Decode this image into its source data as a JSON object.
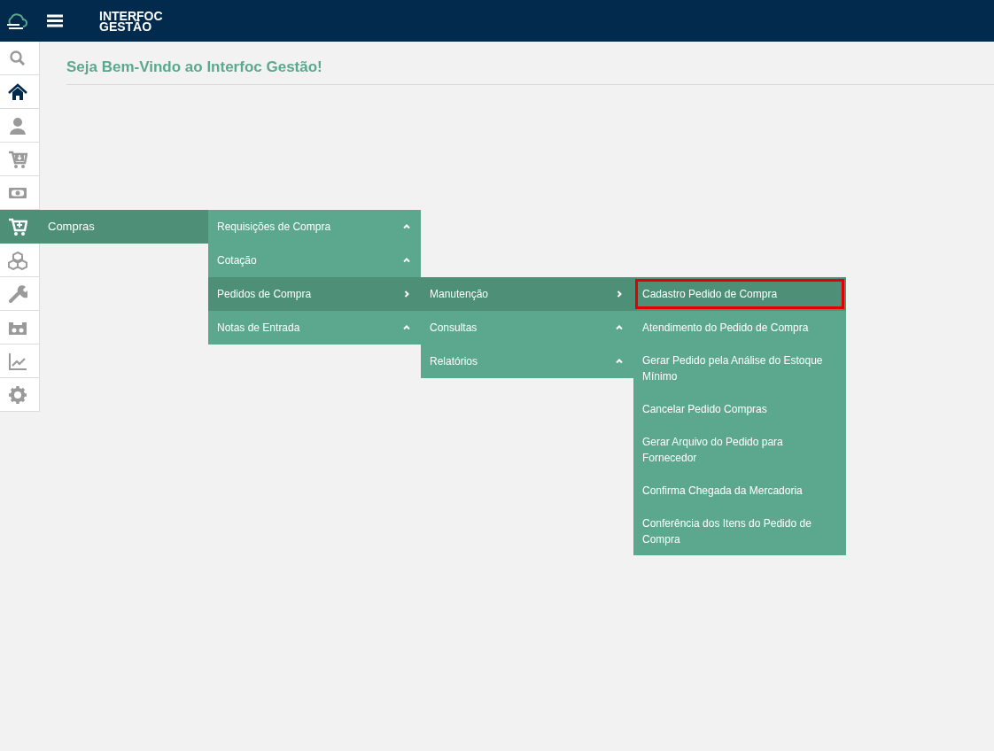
{
  "header": {
    "brand_line1": "INTERFOC",
    "brand_line2": "GESTÃO"
  },
  "sidebar": {
    "items": [
      {
        "kind": "search",
        "current": false,
        "selected": false
      },
      {
        "kind": "home",
        "current": true,
        "selected": false
      },
      {
        "kind": "user",
        "current": false,
        "selected": false
      },
      {
        "kind": "cart-down",
        "current": false,
        "selected": false
      },
      {
        "kind": "money",
        "current": false,
        "selected": false
      },
      {
        "kind": "cart-plus",
        "current": false,
        "selected": true,
        "label": "Compras",
        "children": [
          {
            "label": "Requisições de Compra",
            "kind": "submenu",
            "selected": false
          },
          {
            "label": "Cotação",
            "kind": "submenu",
            "selected": false
          },
          {
            "label": "Pedidos de Compra",
            "kind": "submenu",
            "selected": true,
            "children": [
              {
                "label": "Manutenção",
                "kind": "submenu",
                "selected": true,
                "children": [
                  {
                    "label": "Cadastro Pedido de Compra",
                    "kind": "action",
                    "selected": true,
                    "highlighted": true
                  },
                  {
                    "label": "Atendimento do Pedido de Compra",
                    "kind": "action",
                    "selected": false,
                    "highlighted": false
                  },
                  {
                    "label": "Gerar Pedido pela Análise do Estoque Mínimo",
                    "kind": "action",
                    "selected": false,
                    "highlighted": false
                  },
                  {
                    "label": "Cancelar Pedido Compras",
                    "kind": "action",
                    "selected": false,
                    "highlighted": false
                  },
                  {
                    "label": "Gerar Arquivo do Pedido para Fornecedor",
                    "kind": "action",
                    "selected": false,
                    "highlighted": false
                  },
                  {
                    "label": "Confirma Chegada da Mercadoria",
                    "kind": "action",
                    "selected": false,
                    "highlighted": false
                  },
                  {
                    "label": "Conferência dos Itens do Pedido de Compra",
                    "kind": "action",
                    "selected": false,
                    "highlighted": false
                  }
                ]
              },
              {
                "label": "Consultas",
                "kind": "submenu",
                "selected": false
              },
              {
                "label": "Relatórios",
                "kind": "submenu",
                "selected": false
              }
            ]
          },
          {
            "label": "Notas de Entrada",
            "kind": "submenu",
            "selected": false
          }
        ]
      },
      {
        "kind": "boxes",
        "current": false,
        "selected": false
      },
      {
        "kind": "wrench",
        "current": false,
        "selected": false
      },
      {
        "kind": "machine",
        "current": false,
        "selected": false
      },
      {
        "kind": "chart",
        "current": false,
        "selected": false
      },
      {
        "kind": "gear",
        "current": false,
        "selected": false
      }
    ]
  },
  "page_title": "Seja Bem-Vindo ao Interfoc Gestão!"
}
